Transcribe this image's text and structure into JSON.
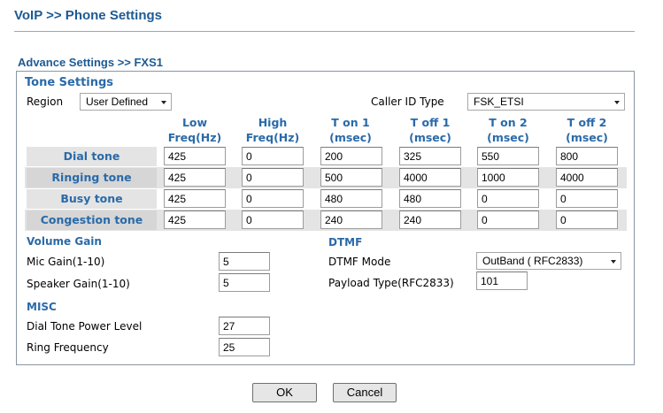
{
  "page_title": "VoIP >> Phone Settings",
  "section_title": "Advance Settings >> FXS1",
  "tone_settings": {
    "heading": "Tone Settings",
    "region_label": "Region",
    "region_value": "User Defined",
    "caller_id_label": "Caller ID Type",
    "caller_id_value": "FSK_ETSI",
    "columns": [
      [
        "Low",
        "Freq(Hz)"
      ],
      [
        "High",
        "Freq(Hz)"
      ],
      [
        "T on 1",
        "(msec)"
      ],
      [
        "T off 1",
        "(msec)"
      ],
      [
        "T on 2",
        "(msec)"
      ],
      [
        "T off 2",
        "(msec)"
      ]
    ],
    "rows": [
      {
        "label": "Dial tone",
        "values": [
          "425",
          "0",
          "200",
          "325",
          "550",
          "800"
        ]
      },
      {
        "label": "Ringing tone",
        "values": [
          "425",
          "0",
          "500",
          "4000",
          "1000",
          "4000"
        ]
      },
      {
        "label": "Busy tone",
        "values": [
          "425",
          "0",
          "480",
          "480",
          "0",
          "0"
        ]
      },
      {
        "label": "Congestion tone",
        "values": [
          "425",
          "0",
          "240",
          "240",
          "0",
          "0"
        ]
      }
    ]
  },
  "volume_gain": {
    "heading": "Volume Gain",
    "mic_label": "Mic Gain(1-10)",
    "mic_value": "5",
    "speaker_label": "Speaker Gain(1-10)",
    "speaker_value": "5"
  },
  "dtmf": {
    "heading": "DTMF",
    "mode_label": "DTMF Mode",
    "mode_value": "OutBand ( RFC2833)",
    "payload_label": "Payload Type(RFC2833)",
    "payload_value": "101"
  },
  "misc": {
    "heading": "MISC",
    "dial_power_label": "Dial Tone Power Level",
    "dial_power_value": "27",
    "ring_freq_label": "Ring Frequency",
    "ring_freq_value": "25"
  },
  "buttons": {
    "ok": "OK",
    "cancel": "Cancel"
  },
  "colors": {
    "heading_blue": "#1d5a93",
    "label_blue": "#2a6aa8",
    "row_band": "#e4e4e4"
  }
}
